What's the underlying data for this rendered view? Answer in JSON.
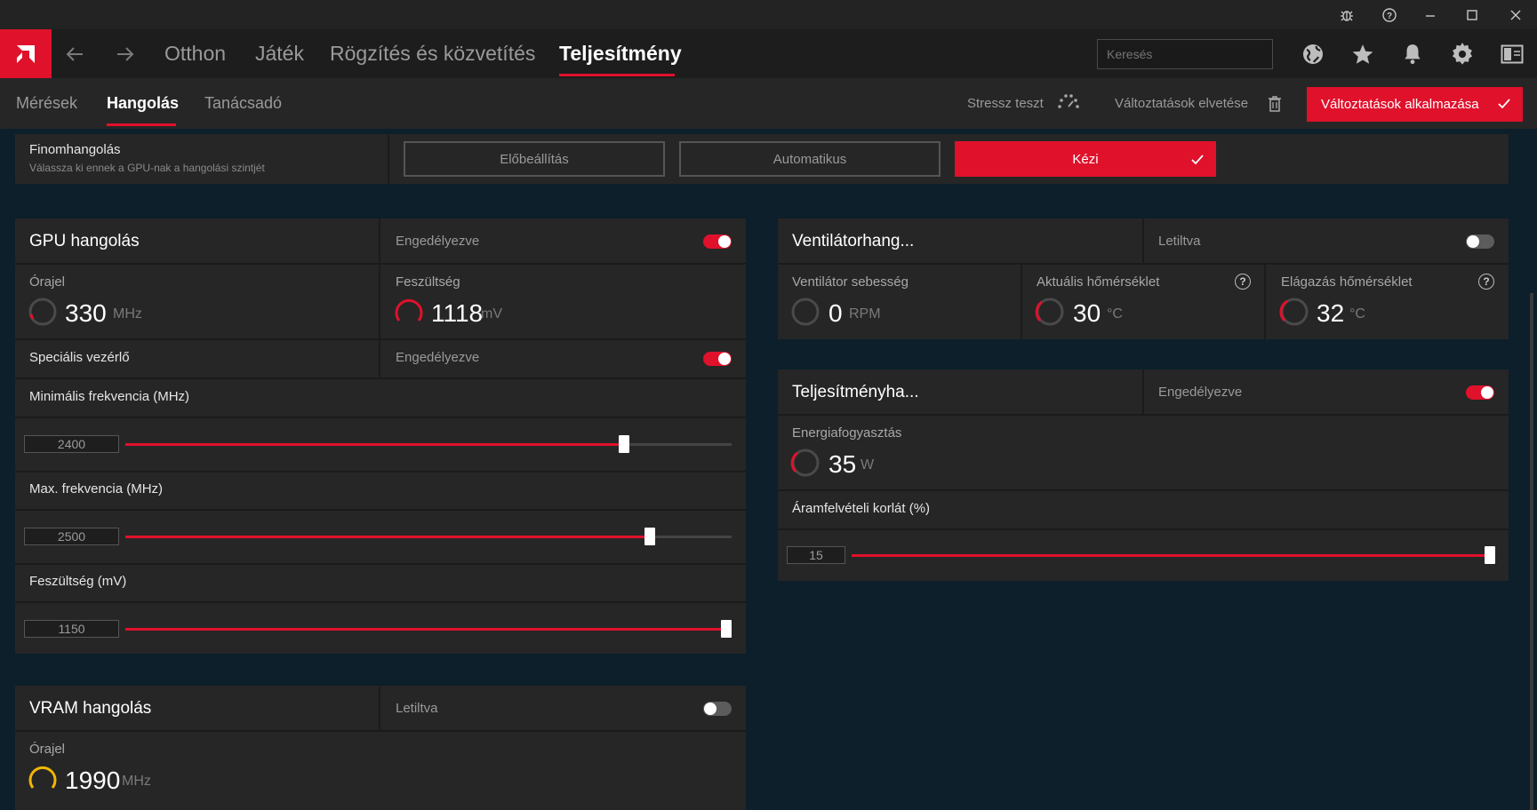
{
  "window": {
    "controls": [
      "bug-report-icon",
      "help-icon",
      "minimize-icon",
      "maximize-icon",
      "close-icon"
    ]
  },
  "nav": {
    "tabs": [
      "Otthon",
      "Játék",
      "Rögzítés és közvetítés",
      "Teljesítmény"
    ],
    "active_tab": "Teljesítmény",
    "search_placeholder": "Keresés",
    "icons": [
      "globe-icon",
      "star-icon",
      "bell-icon",
      "gear-icon",
      "sidebar-icon"
    ]
  },
  "subnav": {
    "tabs": [
      "Mérések",
      "Hangolás",
      "Tanácsadó"
    ],
    "active_tab": "Hangolás",
    "stress_test": "Stressz teszt",
    "discard": "Változtatások elvetése",
    "apply": "Változtatások alkalmazása"
  },
  "fine_tuning": {
    "title": "Finomhangolás",
    "subtitle": "Válassza ki ennek a GPU-nak a hangolási szintjét",
    "modes": [
      "Előbeállítás",
      "Automatikus",
      "Kézi"
    ],
    "selected": "Kézi"
  },
  "gpu": {
    "title": "GPU hangolás",
    "status": "Engedélyezve",
    "enabled": true,
    "clock_label": "Órajel",
    "clock_value": "330",
    "clock_unit": "MHz",
    "voltage_label": "Feszültség",
    "voltage_value": "1118",
    "voltage_unit": "mV",
    "advanced_label": "Speciális vezérlő",
    "advanced_status": "Engedélyezve",
    "advanced_enabled": true,
    "min_freq_label": "Minimális frekvencia (MHz)",
    "min_freq_value": "2400",
    "min_freq_fraction": 0.822,
    "max_freq_label": "Max. frekvencia (MHz)",
    "max_freq_value": "2500",
    "max_freq_fraction": 0.865,
    "volt_label": "Feszültség (mV)",
    "volt_value": "1150",
    "volt_fraction": 1.0
  },
  "fan": {
    "title": "Ventilátorhang...",
    "status": "Letiltva",
    "enabled": false,
    "speed_label": "Ventilátor sebesség",
    "speed_value": "0",
    "speed_unit": "RPM",
    "temp_label": "Aktuális hőmérséklet",
    "temp_value": "30",
    "temp_unit": "°C",
    "junction_label": "Elágazás hőmérséklet",
    "junction_value": "32",
    "junction_unit": "°C"
  },
  "power": {
    "title": "Teljesítményha...",
    "status": "Engedélyezve",
    "enabled": true,
    "consumption_label": "Energiafogyasztás",
    "consumption_value": "35",
    "consumption_unit": "W",
    "limit_label": "Áramfelvételi korlát (%)",
    "limit_value": "15",
    "limit_fraction": 1.0
  },
  "vram": {
    "title": "VRAM hangolás",
    "status": "Letiltva",
    "enabled": false,
    "clock_label": "Órajel",
    "clock_value": "1990",
    "clock_unit": "MHz"
  },
  "colors": {
    "accent": "#e0112b",
    "gauge_vram": "#f2b705",
    "panel": "#262626",
    "background": "#0c1f2b"
  }
}
